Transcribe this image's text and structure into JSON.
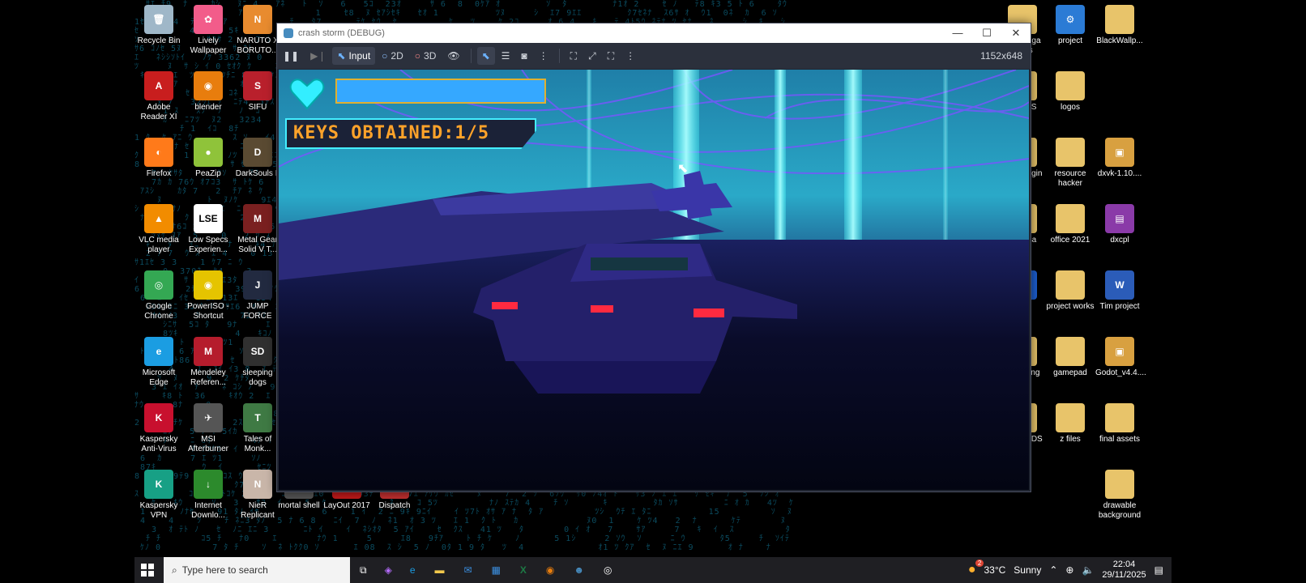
{
  "desktop": {
    "icons_left": [
      {
        "label": "Recycle Bin",
        "color": "#9fb7c8",
        "glyph": "🗑"
      },
      {
        "label": "Lively\nWallpaper",
        "color": "#f25c8a",
        "glyph": "✿"
      },
      {
        "label": "NARUTO X\nBORUTO...",
        "color": "#e88b2f",
        "glyph": "N"
      },
      {
        "label": "Adobe\nReader XI",
        "color": "#c81e1e",
        "glyph": "A"
      },
      {
        "label": "blender",
        "color": "#e87d0d",
        "glyph": "◉"
      },
      {
        "label": "SIFU",
        "color": "#b9202c",
        "glyph": "S"
      },
      {
        "label": "Firefox",
        "color": "#ff7a1a",
        "glyph": "◐"
      },
      {
        "label": "PeaZip",
        "color": "#8fc33a",
        "glyph": "●"
      },
      {
        "label": "DarkSouls II",
        "color": "#5a4a32",
        "glyph": "D"
      },
      {
        "label": "VLC media\nplayer",
        "color": "#f28c00",
        "glyph": "▲"
      },
      {
        "label": "Low Specs\nExperien...",
        "color": "#ffffff",
        "glyph": "LSE"
      },
      {
        "label": "Metal Gear\nSolid V T...",
        "color": "#7a2020",
        "glyph": "M"
      },
      {
        "label": "Google\nChrome",
        "color": "#34a853",
        "glyph": "◎"
      },
      {
        "label": "PowerISO -\nShortcut",
        "color": "#e5c400",
        "glyph": "◉"
      },
      {
        "label": "JUMP FORCE",
        "color": "#222a40",
        "glyph": "J"
      },
      {
        "label": "Microsoft\nEdge",
        "color": "#1b9de2",
        "glyph": "e"
      },
      {
        "label": "Mendeley\nReferen...",
        "color": "#b51c2c",
        "glyph": "M"
      },
      {
        "label": "sleeping\ndogs",
        "color": "#303030",
        "glyph": "SD"
      },
      {
        "label": "Kaspersky\nAnti-Virus",
        "color": "#c8102e",
        "glyph": "K"
      },
      {
        "label": "MSI\nAfterburner",
        "color": "#555",
        "glyph": "✈"
      },
      {
        "label": "Tales of\nMonk...",
        "color": "#3f7a44",
        "glyph": "T"
      },
      {
        "label": "Kaspersky\nVPN",
        "color": "#17a085",
        "glyph": "K"
      },
      {
        "label": "Internet\nDownlo...",
        "color": "#2c8a2c",
        "glyph": "↓"
      },
      {
        "label": "NieR\nReplicant",
        "color": "#c9b6a9",
        "glyph": "N"
      }
    ],
    "icons_bottom_mid": [
      {
        "label": "mortal shell",
        "color": "#555",
        "glyph": "M"
      },
      {
        "label": "LayOut 2017",
        "color": "#c01a1a",
        "glyph": "L"
      },
      {
        "label": "Dispatch",
        "color": "#c03030",
        "glyph": "D"
      }
    ],
    "icons_right": [
      {
        "label": "roup egga\nslides",
        "color": "#e8c46a",
        "glyph": ""
      },
      {
        "label": "project",
        "color": "#2b7bd5",
        "glyph": "⚙"
      },
      {
        "label": "BlackWallp...",
        "color": "#e8c46a",
        "glyph": ""
      },
      {
        "label": "IT PICS",
        "color": "#e8c46a",
        "glyph": ""
      },
      {
        "label": "logos",
        "color": "#e8c46a",
        "glyph": ""
      },
      {
        "label": "odot plugin",
        "color": "#e8c46a",
        "glyph": ""
      },
      {
        "label": "resource\nhacker",
        "color": "#e8c46a",
        "glyph": ""
      },
      {
        "label": "dxvk-1.10....",
        "color": "#d8a040",
        "glyph": "▣"
      },
      {
        "label": "assetsa",
        "color": "#e8c46a",
        "glyph": ""
      },
      {
        "label": "office 2021",
        "color": "#e8c46a",
        "glyph": ""
      },
      {
        "label": "dxcpl",
        "color": "#8a3aa8",
        "glyph": "▤"
      },
      {
        "label": "dxcpl",
        "color": "#1d5fd0",
        "glyph": "✕"
      },
      {
        "label": "project works",
        "color": "#e8c46a",
        "glyph": ""
      },
      {
        "label": "Tim project",
        "color": "#2b5cb8",
        "glyph": "W"
      },
      {
        "label": "modelling",
        "color": "#e8c46a",
        "glyph": ""
      },
      {
        "label": "gamepad",
        "color": "#e8c46a",
        "glyph": ""
      },
      {
        "label": "Godot_v4.4....",
        "color": "#d8a040",
        "glyph": "▣"
      },
      {
        "label": "NEW VIDS",
        "color": "#e8c46a",
        "glyph": ""
      },
      {
        "label": "z files",
        "color": "#e8c46a",
        "glyph": ""
      },
      {
        "label": "final assets",
        "color": "#e8c46a",
        "glyph": ""
      },
      {
        "label": "drawable\nbackground",
        "color": "#e8c46a",
        "glyph": ""
      }
    ]
  },
  "window": {
    "title": "crash storm (DEBUG)",
    "toolbar": {
      "input_label": "Input",
      "mode_2d": "2D",
      "mode_3d": "3D",
      "resolution": "1152x648"
    },
    "hud": {
      "keys_text": "KEYS OBTAINED:1/5",
      "health_fraction": 1.0
    }
  },
  "taskbar": {
    "search_placeholder": "Type here to search",
    "weather_badge": "2",
    "weather_temp": "33°C",
    "weather_text": "Sunny",
    "time": "22:04",
    "date": "29/11/2025"
  }
}
